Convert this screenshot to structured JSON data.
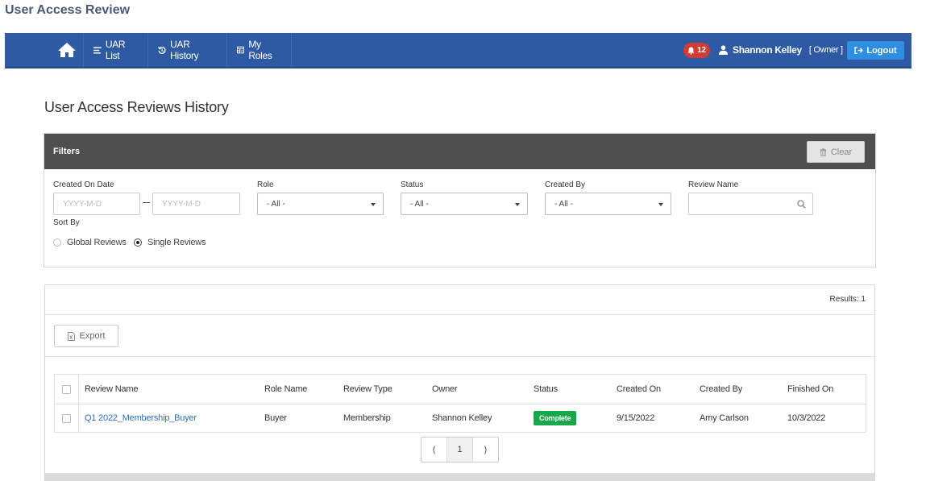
{
  "app": {
    "title": "User Access Review"
  },
  "navbar": {
    "bg_color": "#2e5aa3",
    "home_icon": "home-icon",
    "items": [
      {
        "label": "UAR List",
        "icon": "list-icon"
      },
      {
        "label": "UAR History",
        "icon": "history-icon"
      },
      {
        "label": "My Roles",
        "icon": "table-icon"
      }
    ],
    "notifications": {
      "count": "12",
      "icon": "bell-icon",
      "color": "#d23a33"
    },
    "user": {
      "name": "Shannon Kelley",
      "role": "[ Owner ]",
      "icon": "user-icon"
    },
    "logout": {
      "label": "Logout",
      "icon": "logout-icon",
      "color": "#2f8ee0"
    }
  },
  "page": {
    "title": "User Access Reviews History"
  },
  "filters": {
    "title": "Filters",
    "clear_label": "Clear",
    "created_on_label": "Created On Date",
    "date_from_placeholder": "YYYY-M-D",
    "date_to_placeholder": "YYYY-M-D",
    "role_label": "Role",
    "role_value": "- All -",
    "status_label": "Status",
    "status_value": "- All -",
    "created_by_label": "Created By",
    "created_by_value": "- All -",
    "review_name_label": "Review Name",
    "review_name_value": "",
    "sort_by_label": "Sort By",
    "sort_options": [
      {
        "label": "Global Reviews",
        "selected": false
      },
      {
        "label": "Single Reviews",
        "selected": true
      }
    ]
  },
  "results": {
    "count_text": "Results: 1",
    "export_label": "Export",
    "columns": [
      "Review Name",
      "Role Name",
      "Review Type",
      "Owner",
      "Status",
      "Created On",
      "Created By",
      "Finished On"
    ],
    "rows": [
      {
        "review_name": "Q1 2022_Membership_Buyer",
        "role_name": "Buyer",
        "review_type": "Membership",
        "owner": "Shannon Kelley",
        "status": "Complete",
        "created_on": "9/15/2022",
        "created_by": "Amy Carlson",
        "finished_on": "10/3/2022"
      }
    ],
    "status_color": "#1aa64a",
    "pagination": {
      "prev": "⟨",
      "current": "1",
      "next": "⟩"
    }
  }
}
